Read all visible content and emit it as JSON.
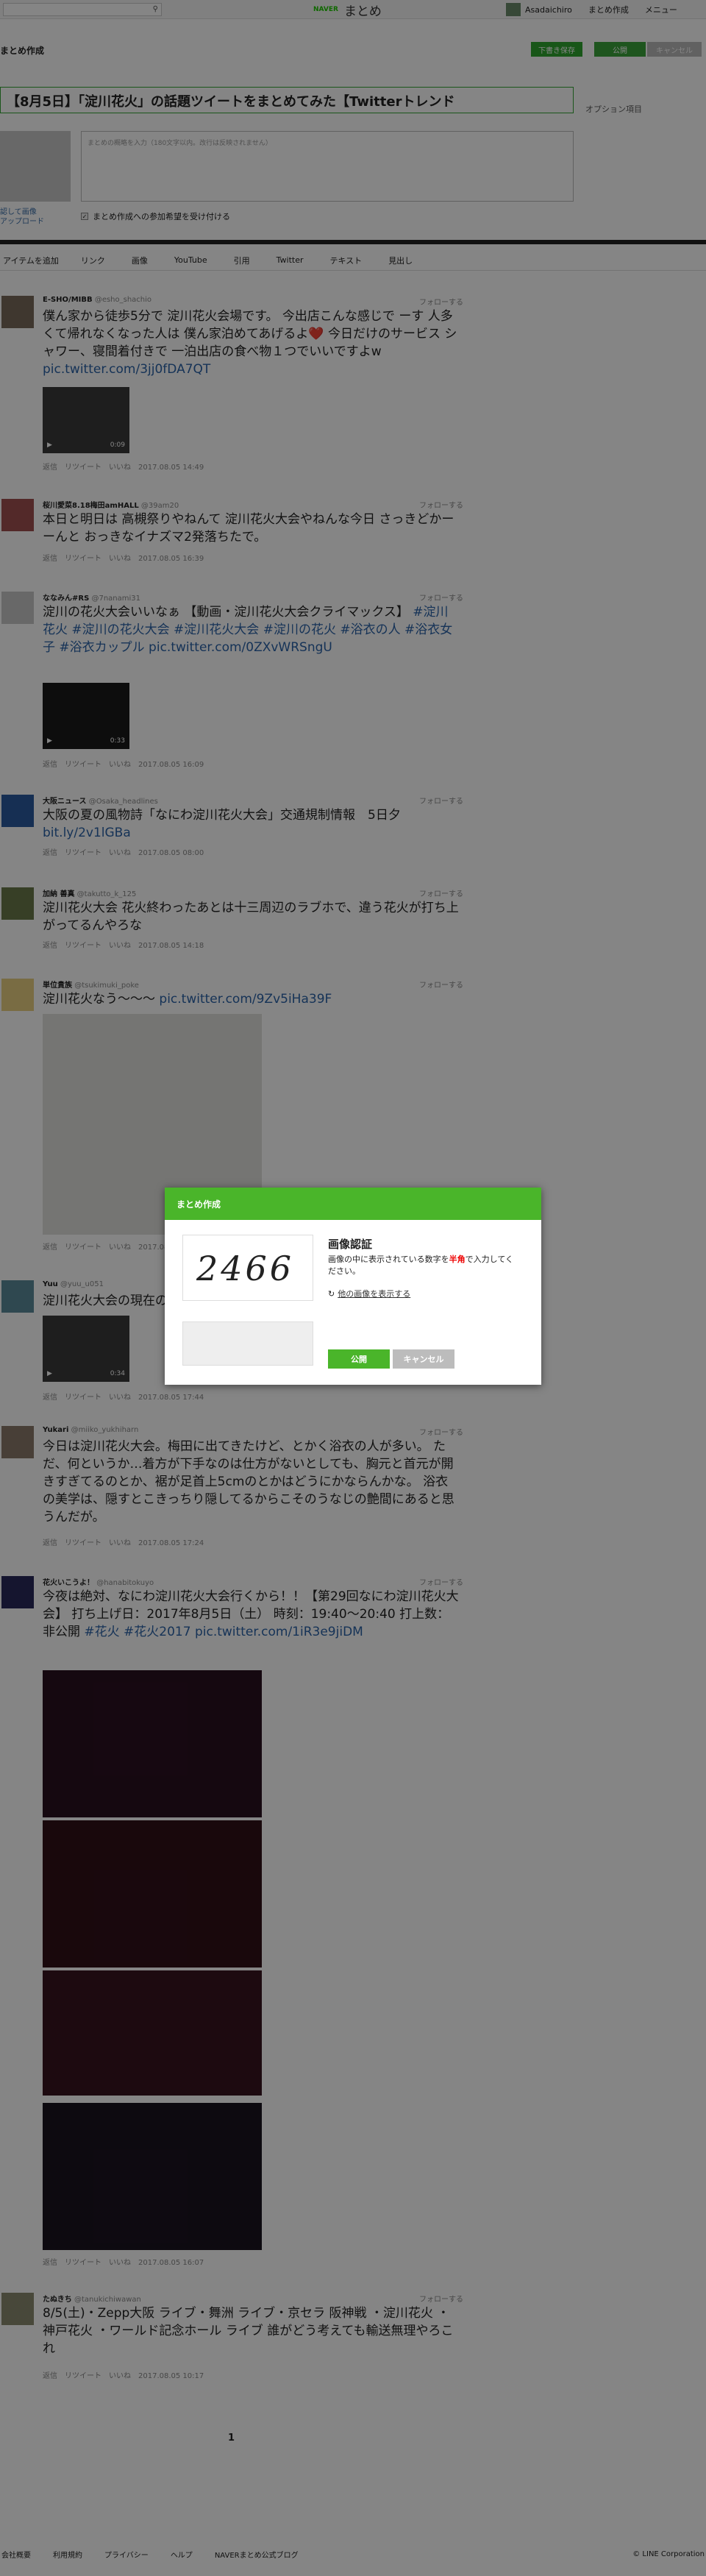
{
  "topbar": {
    "search_icon": "search-icon",
    "logo_naver": "NAVER",
    "logo_matome": "まとめ",
    "user": "Asadaichiro",
    "create": "まとめ作成",
    "menu": "メニュー"
  },
  "edit": {
    "label": "まとめ作成",
    "draft": "下書き保存",
    "publish": "公開",
    "cancel": "キャンセル",
    "title": "【8月5日】「淀川花火」の話題ツイートをまとめてみた【Twitterトレンド",
    "options": "オプション項目",
    "upload": "認して画像\nアップロード",
    "desc_placeholder": "まとめの概略を入力（180文字以内。改行は反映されません）",
    "checkbox": "まとめ作成への参加希望を受け付ける"
  },
  "toolbar": [
    "アイテムを追加",
    "リンク",
    "画像",
    "YouTube",
    "引用",
    "Twitter",
    "テキスト",
    "見出し"
  ],
  "tweets": [
    {
      "name": "E-SHO/MIBB",
      "handle": "@esho_shachio",
      "text": "僕ん家から徒歩5分で 淀川花火会場です。 今出店こんな感じで ーす 人多くて帰れなくなった人は 僕ん家泊めてあげるよ❤️ 今日だけのサービス シャワー、寝間着付きで 一泊出店の食べ物１つでいいですよw ",
      "link": "pic.twitter.com/3jj0fDA7QT",
      "duration": "0:09",
      "time": "2017.08.05 14:49"
    },
    {
      "name": "桜川愛菜8.18梅田amHALL",
      "handle": "@39am20",
      "text": "本日と明日は 高槻祭りやねんて 淀川花火大会やねんな今日 さっきどかーーんと おっきなイナズマ2発落ちたで。",
      "link": "",
      "time": "2017.08.05 16:39"
    },
    {
      "name": "ななみん#RS",
      "handle": "@7nanami31",
      "text": "淀川の花火大会いいなぁ 【動画・淀川花火大会クライマックス】 ",
      "link": "#淀川花火 #淀川の花火大会 #淀川花火大会 #淀川の花火 #浴衣の人 #浴衣女子 #浴衣カップル pic.twitter.com/0ZXvWRSngU",
      "duration": "0:33",
      "time": "2017.08.05 16:09"
    },
    {
      "name": "大阪ニュース",
      "handle": "@Osaka_headlines",
      "text": "大阪の夏の風物詩「なにわ淀川花火大会」交通規制情報　5日夕 ",
      "link": "bit.ly/2v1lGBa",
      "time": "2017.08.05 08:00"
    },
    {
      "name": "加納 善真",
      "handle": "@takutto_k_125",
      "text": "淀川花火大会 花火終わったあとは十三周辺のラブホで、違う花火が打ち上がってるんやろな",
      "link": "",
      "time": "2017.08.05 14:18"
    },
    {
      "name": "単位貴族",
      "handle": "@tsukimuki_poke",
      "text": "淀川花火なう〜〜〜 ",
      "link": "pic.twitter.com/9Zv5iHa39F",
      "time": "2017.08.05 19:45"
    },
    {
      "name": "Yuu",
      "handle": "@yuu_u051",
      "text": "淀川花火大会の現在の様子...",
      "link": "",
      "duration": "0:34",
      "time": "2017.08.05 17:44"
    },
    {
      "name": "Yukari",
      "handle": "@miiko_yukhiharn",
      "text": "今日は淀川花火大会。梅田に出てきたけど、とかく浴衣の人が多い。 ただ、何というか…着方が下手なのは仕方がないとしても、胸元と首元が開きすぎてるのとか、裾が足首上5cmのとかはどうにかならんかな。 浴衣の美学は、隠すとこきっちり隠してるからこそのうなじの艶間にあると思うんだが。",
      "link": "",
      "time": "2017.08.05 17:24"
    },
    {
      "name": "花火いこうよ！",
      "handle": "@hanabitokuyo",
      "text": "今夜は絶対、なにわ淀川花火大会行くから！！【第29回なにわ淀川花火大会】 打ち上げ日：2017年8月5日（土） 時刻：19:40〜20:40 打上数：非公開 ",
      "link": "#花火 #花火2017 pic.twitter.com/1iR3e9jiDM",
      "time": "2017.08.05 16:07"
    },
    {
      "name": "たぬきち",
      "handle": "@tanukichiwawan",
      "text": "8/5(土)・Zepp大阪 ライブ・舞洲 ライブ・京セラ 阪神戦 ・淀川花火 ・神戸花火 ・ワールド記念ホール ライブ 誰がどう考えても輸送無理やろこれ",
      "link": "",
      "time": "2017.08.05 10:17"
    }
  ],
  "tweet_actions": {
    "reply": "返信",
    "retweet": "リツイート",
    "like": "いいね",
    "follow": "フォローする"
  },
  "modal": {
    "header": "まとめ作成",
    "captcha": "2466",
    "title": "画像認証",
    "desc_pre": "画像の中に表示されている数字を",
    "desc_red": "半角",
    "desc_post": "で入力してください。",
    "other": "他の画像を表示する",
    "publish": "公開",
    "cancel": "キャンセル"
  },
  "pager": "1",
  "footer": {
    "links": [
      "会社概要",
      "利用規約",
      "プライバシー",
      "ヘルプ",
      "NAVERまとめ公式ブログ"
    ],
    "copyright": "© LINE Corporation"
  }
}
